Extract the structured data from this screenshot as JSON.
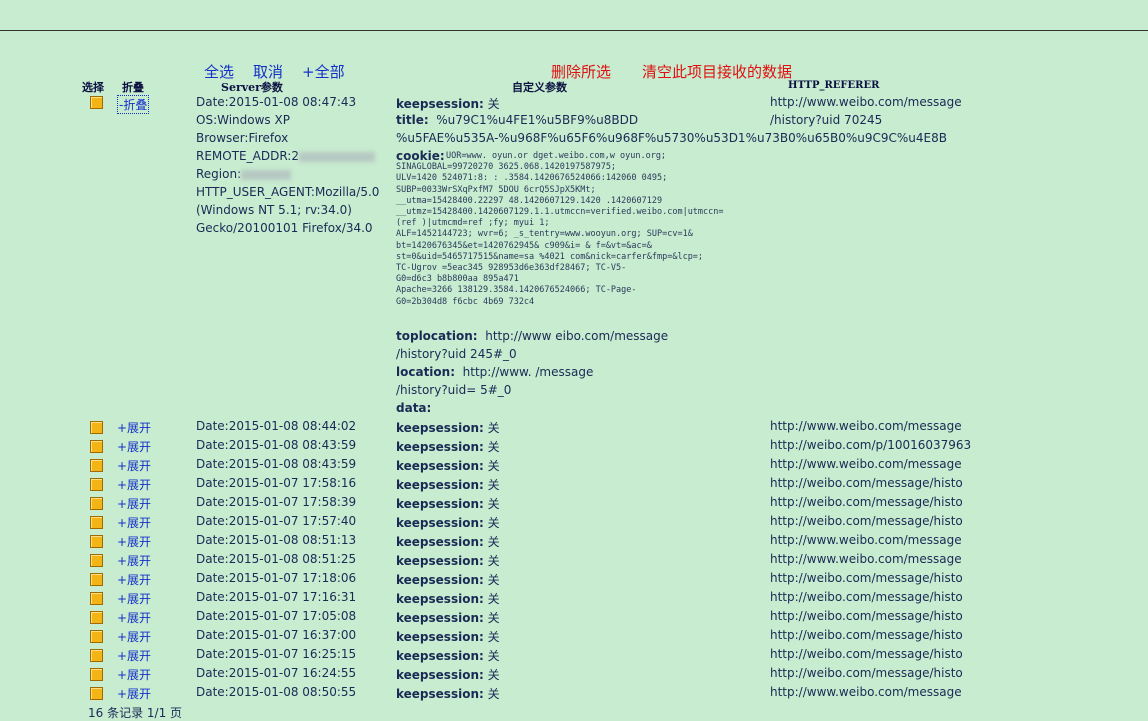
{
  "actions": {
    "select_all": "全选",
    "cancel": "取消",
    "all": "+全部",
    "delete_selected": "删除所选",
    "clear_all": "清空此项目接收的数据"
  },
  "headers": {
    "select": "选择",
    "fold": "折叠",
    "server": "Server参数",
    "custom": "自定义参数",
    "referer": "HTTP_REFERER"
  },
  "expanded": {
    "toggle": "-折叠",
    "server_lines": [
      "Date:2015-01-08 08:47:43",
      "OS:Windows XP",
      "Browser:Firefox",
      "REMOTE_ADDR:2",
      "Region:",
      "HTTP_USER_AGENT:Mozilla/5.0",
      "(Windows NT 5.1; rv:34.0)",
      "Gecko/20100101 Firefox/34.0"
    ],
    "keepsession_label": "keepsession:",
    "keepsession_value": "关",
    "title_label": "title:",
    "title_value": "%u79C1%u4FE1%u5BF9%u8BDD",
    "title_line2": "%u5FAE%u535A-%u968F%u65F6%u968F%u5730%u53D1%u73B0%u65B0%u9C9C%u4E8B",
    "cookie_label": "cookie:",
    "cookie_lines": [
      "UOR=www.    oyun.or    dget.weibo.com,w     oyun.org;",
      "SINAGLOBAL=99720270 3625.068.1420197587975;",
      "ULV=1420    524071:8:    :    .3584.1420676524066:142060    0495;",
      "SUBP=0033WrSXqPxfM7          5DOU    6crQ5SJpX5KMt;",
      "__utma=15428400.22297    48.1420607129.1420    .1420607129",
      "__utmz=15428400.1420607129.1.1.utmccn=verified.weibo.com|utmccn=",
      "(ref    )|utmcmd=ref                   ;fy; myui    1;",
      "ALF=1452144723; wvr=6; _s_tentry=www.wooyun.org; SUP=cv=1&",
      "bt=1420676345&et=1420762945&    c909&i=    &    f=&vt=&ac=&",
      "st=0&uid=5465717515&name=sa    %4021    com&nick=carfer&fmp=&lcp=;",
      "TC-Ugrov    =5eac345    928953d6e363df28467; TC-V5-",
      "G0=d6c3    b8b800aa    895a471",
      "Apache=3266      138129.3584.1420676524066; TC-Page-",
      "G0=2b304d8    f6cbc    4b69    732c4"
    ],
    "toplocation_label": "toplocation:",
    "toplocation_value": "http://www    eibo.com/message",
    "toplocation_line2": "/history?uid        245#_0",
    "location_label": "location:",
    "location_value": "http://www.           /message",
    "location_line2": "/history?uid=      5#_0",
    "data_label": "data:",
    "referer_line1": "http://www.weibo.com/message",
    "referer_line2": "/history?uid      70245"
  },
  "rows": [
    {
      "toggle": "+展开",
      "date": "Date:2015-01-08 08:44:02",
      "ks": "keepsession:",
      "ksv": "关",
      "ref": "http://www.weibo.com/message"
    },
    {
      "toggle": "+展开",
      "date": "Date:2015-01-08 08:43:59",
      "ks": "keepsession:",
      "ksv": "关",
      "ref": "http://weibo.com/p/10016037963"
    },
    {
      "toggle": "+展开",
      "date": "Date:2015-01-08 08:43:59",
      "ks": "keepsession:",
      "ksv": "关",
      "ref": "http://www.weibo.com/message"
    },
    {
      "toggle": "+展开",
      "date": "Date:2015-01-07 17:58:16",
      "ks": "keepsession:",
      "ksv": "关",
      "ref": "http://weibo.com/message/histo"
    },
    {
      "toggle": "+展开",
      "date": "Date:2015-01-07 17:58:39",
      "ks": "keepsession:",
      "ksv": "关",
      "ref": "http://weibo.com/message/histo"
    },
    {
      "toggle": "+展开",
      "date": "Date:2015-01-07 17:57:40",
      "ks": "keepsession:",
      "ksv": "关",
      "ref": "http://weibo.com/message/histo"
    },
    {
      "toggle": "+展开",
      "date": "Date:2015-01-08 08:51:13",
      "ks": "keepsession:",
      "ksv": "关",
      "ref": "http://www.weibo.com/message"
    },
    {
      "toggle": "+展开",
      "date": "Date:2015-01-08 08:51:25",
      "ks": "keepsession:",
      "ksv": "关",
      "ref": "http://www.weibo.com/message"
    },
    {
      "toggle": "+展开",
      "date": "Date:2015-01-07 17:18:06",
      "ks": "keepsession:",
      "ksv": "关",
      "ref": "http://weibo.com/message/histo"
    },
    {
      "toggle": "+展开",
      "date": "Date:2015-01-07 17:16:31",
      "ks": "keepsession:",
      "ksv": "关",
      "ref": "http://weibo.com/message/histo"
    },
    {
      "toggle": "+展开",
      "date": "Date:2015-01-07 17:05:08",
      "ks": "keepsession:",
      "ksv": "关",
      "ref": "http://weibo.com/message/histo"
    },
    {
      "toggle": "+展开",
      "date": "Date:2015-01-07 16:37:00",
      "ks": "keepsession:",
      "ksv": "关",
      "ref": "http://weibo.com/message/histo"
    },
    {
      "toggle": "+展开",
      "date": "Date:2015-01-07 16:25:15",
      "ks": "keepsession:",
      "ksv": "关",
      "ref": "http://weibo.com/message/histo"
    },
    {
      "toggle": "+展开",
      "date": "Date:2015-01-07 16:24:55",
      "ks": "keepsession:",
      "ksv": "关",
      "ref": "http://weibo.com/message/histo"
    },
    {
      "toggle": "+展开",
      "date": "Date:2015-01-08 08:50:55",
      "ks": "keepsession:",
      "ksv": "关",
      "ref": "http://www.weibo.com/message"
    }
  ],
  "footer": "16 条记录 1/1 页"
}
